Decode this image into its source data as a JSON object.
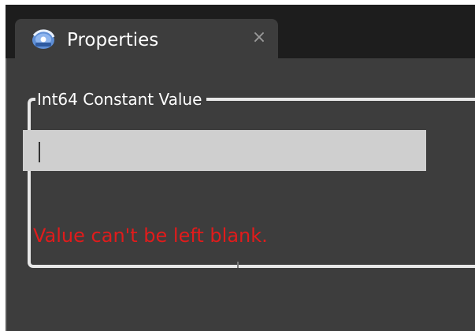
{
  "tab": {
    "title": "Properties",
    "close_glyph": "×",
    "icon": "properties-gear-icon"
  },
  "group": {
    "legend": "Int64 Constant Value"
  },
  "input": {
    "value": "",
    "placeholder": ""
  },
  "validation": {
    "message": "Value can't be left blank."
  },
  "colors": {
    "tab_bar_bg": "#1d1d1d",
    "panel_bg": "#3d3d3d",
    "input_bg": "#cfcfcf",
    "error": "#e11b1b",
    "text": "#ffffff",
    "border": "#e8e8e8"
  }
}
